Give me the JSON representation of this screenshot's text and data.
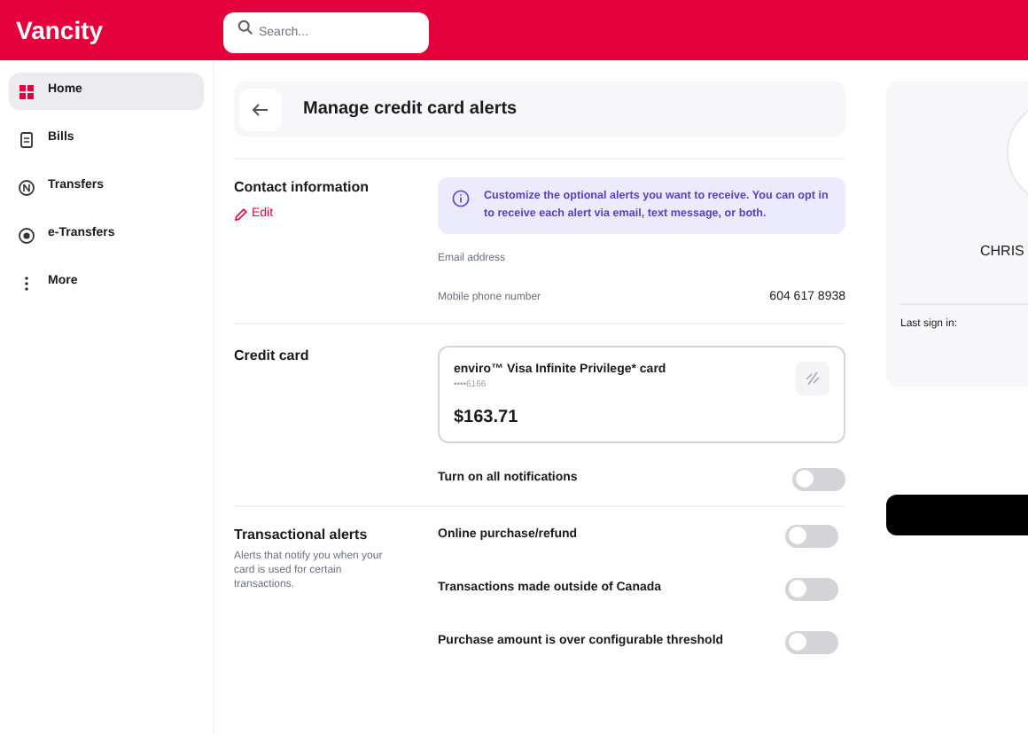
{
  "header": {
    "logo": "Vancity",
    "search": {
      "placeholder": "Search..."
    }
  },
  "sidebar": {
    "items": [
      {
        "label": "Home",
        "selected": true
      },
      {
        "label": "Bills",
        "selected": false
      },
      {
        "label": "Transfers",
        "selected": false
      },
      {
        "label": "e-Transfers",
        "selected": false
      },
      {
        "label": "More",
        "selected": false
      }
    ]
  },
  "page": {
    "title": "Manage credit card alerts"
  },
  "contact": {
    "heading": "Contact information",
    "edit": "Edit",
    "info": "Customize the optional alerts you want to receive. You can opt in to receive each alert via email, text message, or both.",
    "fields": [
      {
        "label": "Email address"
      },
      {
        "label": "Mobile phone number",
        "value": "604 617 8938"
      }
    ]
  },
  "credit_card": {
    "heading": "Credit card",
    "card": {
      "name": "enviro™ Visa Infinite Privilege* card",
      "number": "••••6166",
      "balance": "$163.71"
    },
    "all_notifications": {
      "label": "Turn on all notifications",
      "on": false
    }
  },
  "transactional": {
    "heading": "Transactional alerts",
    "description": "Alerts that notify you when your card is used for certain transactions.",
    "alerts": [
      {
        "label": "Online purchase/refund",
        "on": false
      },
      {
        "label": "Transactions made outside of Canada",
        "on": false
      },
      {
        "label": "Purchase amount is over configurable threshold",
        "on": false
      }
    ]
  },
  "profile": {
    "name": "CHRIS",
    "last_sign_in": "Last sign in:"
  }
}
